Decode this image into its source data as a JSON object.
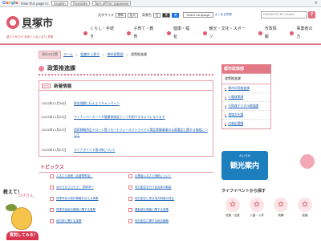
{
  "translate_bar": {
    "logo": [
      "G",
      "o",
      "o",
      "g",
      "l",
      "e"
    ],
    "view_text": "View this page in:",
    "language": "English",
    "translate_button": "Translate",
    "option_text": "Turn off for: Japanese",
    "close": "×"
  },
  "header": {
    "site_title": "貝塚市",
    "site_title_en": "KAIZUKA CITY",
    "tagline": "語らうかだや 未来へつなぐまち 貝塚",
    "tools": [
      "文字サイズ",
      "標準",
      "拡大"
    ],
    "color_label": "背景色",
    "colors": [
      "白",
      "黒",
      "青"
    ],
    "lang_button": "Select Language",
    "sub_link": "よくある質問",
    "search_placeholder": "ENHANCED BY Google",
    "search_icon": "magnifier-icon"
  },
  "global_nav": [
    {
      "label": "くらし・手続き"
    },
    {
      "label": "子育て・教育"
    },
    {
      "label": "健康・福祉"
    },
    {
      "label": "観光・文化・スポーツ"
    },
    {
      "label": "市政情報"
    },
    {
      "label": "事業者の方"
    }
  ],
  "breadcrumb": {
    "here": "現在の位置",
    "items": [
      "ホーム",
      "組織から探す",
      "都市政策部",
      "政策推進課"
    ]
  },
  "page": {
    "title": "政策推進課"
  },
  "news": {
    "badge": "NEW",
    "title": "新着情報",
    "items": [
      {
        "date": "2022年11月30日",
        "text": "税金理解に伝えようキャンペーン"
      },
      {
        "date": "2022年11月22日",
        "text": "マイナンバーカードが健康保険証として利用できるようになります"
      },
      {
        "date": "2022年11月07日",
        "text": "国家戦略特区ドローン等リモートフィールドトライアル実証実験事業の公募選定に関する取組について"
      },
      {
        "date": "2022年11月07日",
        "text": "マイナポイント第2弾について"
      }
    ]
  },
  "topics": {
    "title": "トピックス",
    "items": [
      "ふるさと納税（応援寄附金）",
      "企業版ふるさと納税について",
      "なからかさぶろう！ 貝塚市へ",
      "地方創生を行う自治体の取組",
      "貝塚市民の統計情報を伝える事業",
      "地方創生に係る地方制度の改正",
      "貝塚市版総合戦略に関する事業",
      "基幹統計調査に関する事業",
      "地方税に関する事業",
      "地方創生に関する総合戦略"
    ]
  },
  "mascot": {
    "speech": "教えて！",
    "speech2": "つげさん",
    "ask_button": "質問してみる!"
  },
  "side": {
    "section_title": "都市政策部",
    "current": "政策推進課",
    "items": [
      "都市計画推進課",
      "人権政策課",
      "行財政デジタル推進課",
      "地域文化課",
      "広報広聴課"
    ]
  },
  "tour": {
    "small": "かいづか",
    "big": "観光案内"
  },
  "life": {
    "title": "ライフイベントから探す",
    "items": [
      {
        "label": "妊娠・出産",
        "icon": "baby-icon"
      },
      {
        "label": "入園・入学",
        "icon": "school-icon"
      },
      {
        "label": "就職",
        "icon": "work-icon"
      },
      {
        "label": "結婚",
        "icon": "ring-icon"
      }
    ]
  },
  "colors": {
    "accent": "#e37987",
    "link": "#1a5fb4",
    "button_red": "#d9364f"
  }
}
